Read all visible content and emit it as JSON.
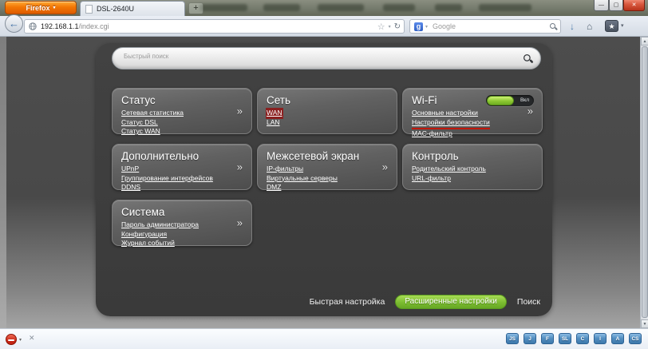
{
  "browser": {
    "firefox_button_label": "Firefox",
    "tab_title": "DSL-2640U",
    "new_tab_label": "+",
    "url_host": "192.168.1.1",
    "url_path": "/index.cgi",
    "search_placeholder": "Google",
    "search_engine_initial": "g"
  },
  "glyphs": {
    "firefox_caret": "▾",
    "window_min": "—",
    "window_max": "▢",
    "window_close": "✕",
    "back_arrow": "←",
    "bookmark_star_outline": "☆",
    "url_caret": "▾",
    "reload": "↻",
    "search_caret": "▾",
    "downloads_arrow": "↓",
    "home": "⌂",
    "bookmarks_star": "★",
    "bookmarks_caret": "▾",
    "scroll_up": "▲",
    "scroll_down": "▼",
    "card_chevron": "»",
    "abp_caret": "▾",
    "bar_close": "✕"
  },
  "page": {
    "quick_search_placeholder": "Быстрый поиск",
    "cards": [
      {
        "title": "Статус",
        "chevron": true,
        "links": [
          {
            "label": "Сетевая статистика"
          },
          {
            "label": "Статус DSL"
          },
          {
            "label": "Статус WAN"
          }
        ]
      },
      {
        "title": "Сеть",
        "chevron": false,
        "links": [
          {
            "label": "WAN",
            "annotation": "red-box"
          },
          {
            "label": "LAN"
          }
        ]
      },
      {
        "title": "Wi-Fi",
        "chevron": true,
        "toggle": {
          "on": true,
          "state_label": "Вкл"
        },
        "links": [
          {
            "label": "Основные настройки"
          },
          {
            "label": "Настройки безопасности",
            "annotation": "red-underline"
          },
          {
            "label": "MAC-фильтр"
          }
        ]
      },
      {
        "title": "Дополнительно",
        "chevron": true,
        "links": [
          {
            "label": "UPnP"
          },
          {
            "label": "Группирование интерфейсов"
          },
          {
            "label": "DDNS"
          }
        ]
      },
      {
        "title": "Межсетевой экран",
        "chevron": true,
        "links": [
          {
            "label": "IP-фильтры"
          },
          {
            "label": "Виртуальные серверы"
          },
          {
            "label": "DMZ"
          }
        ]
      },
      {
        "title": "Контроль",
        "chevron": false,
        "links": [
          {
            "label": "Родительский контроль"
          },
          {
            "label": "URL-фильтр"
          }
        ]
      },
      {
        "title": "Система",
        "chevron": true,
        "links": [
          {
            "label": "Пароль администратора"
          },
          {
            "label": "Конфигурация"
          },
          {
            "label": "Журнал событий"
          }
        ]
      }
    ],
    "footer": {
      "quick_setup_label": "Быстрая настройка",
      "advanced_label": "Расширенные настройки",
      "search_label": "Поиск"
    },
    "accent_green": "#7cbc31",
    "annotation_red": "#c1170b"
  },
  "addon_bar": {
    "dev_icons": [
      "JS",
      "J",
      "F",
      "SL",
      "C",
      "I",
      "A",
      "CS"
    ]
  }
}
